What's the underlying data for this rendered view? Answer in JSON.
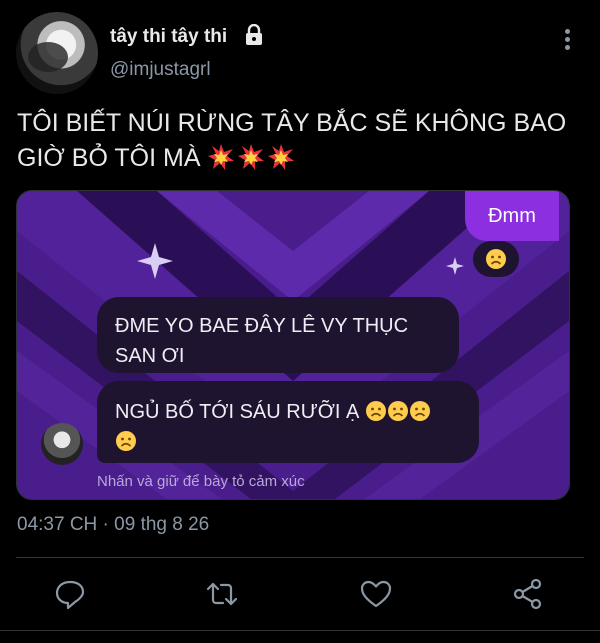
{
  "author": {
    "display_name": "tây thi tây thi",
    "handle": "@imjustagrl",
    "protected_icon": "lock-icon"
  },
  "tweet": {
    "text": "TÔI BIẾT NÚI RỪNG TÂY BẮC SẼ KHÔNG BAO GIỜ BỎ TÔI MÀ",
    "emojis": [
      "collision-emoji",
      "collision-emoji",
      "collision-emoji"
    ]
  },
  "media": {
    "my_message": "Đmm",
    "my_message_reaction": "frowning-face-emoji",
    "messages": [
      {
        "text": "ĐME YO BAE ĐÂY LÊ VY THỤC SAN ƠI"
      },
      {
        "text": "NGỦ BỐ TỚI SÁU RƯỠI Ạ",
        "emojis": [
          "frowning-face-emoji",
          "frowning-face-emoji",
          "frowning-face-emoji",
          "frowning-face-emoji"
        ]
      }
    ],
    "hint": "Nhấn và giữ để bày tỏ cảm xúc",
    "colors": {
      "accent": "#8b2fe0",
      "bubble": "#1e1430",
      "bg": "#4a1d8c"
    }
  },
  "timestamp": "04:37 CH · 09 thg 8 26",
  "actions": [
    "reply-icon",
    "retweet-icon",
    "like-icon",
    "share-icon"
  ]
}
